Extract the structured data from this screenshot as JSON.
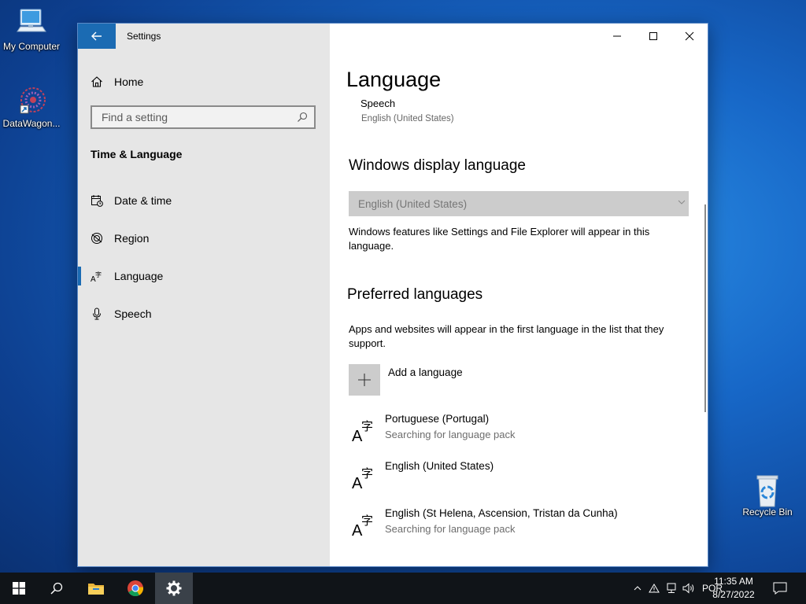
{
  "desktop": {
    "icons": [
      {
        "label": "My Computer",
        "icon": "computer-icon"
      },
      {
        "label": "DataWagon...",
        "icon": "datawagon-shortcut-icon"
      },
      {
        "label": "Recycle Bin",
        "icon": "recycle-bin-icon"
      }
    ]
  },
  "window": {
    "title": "Settings",
    "controls": {
      "minimize": "minimize-icon",
      "maximize": "maximize-icon",
      "close": "close-icon"
    }
  },
  "sidebar": {
    "home_label": "Home",
    "search_placeholder": "Find a setting",
    "section_title": "Time & Language",
    "items": [
      {
        "label": "Date & time",
        "icon": "calendar-clock-icon"
      },
      {
        "label": "Region",
        "icon": "globe-icon"
      },
      {
        "label": "Language",
        "icon": "language-icon",
        "selected": true
      },
      {
        "label": "Speech",
        "icon": "microphone-icon"
      }
    ]
  },
  "main": {
    "page_title": "Language",
    "speech": {
      "label": "Speech",
      "value": "English (United States)"
    },
    "display_language": {
      "heading": "Windows display language",
      "selected": "English (United States)",
      "description": "Windows features like Settings and File Explorer will appear in this language."
    },
    "preferred": {
      "heading": "Preferred languages",
      "description": "Apps and websites will appear in the first language in the list that they support.",
      "add_label": "Add a language",
      "languages": [
        {
          "name": "Portuguese (Portugal)",
          "status": "Searching for language pack"
        },
        {
          "name": "English (United States)",
          "status": ""
        },
        {
          "name": "English (St Helena, Ascension, Tristan da Cunha)",
          "status": "Searching for language pack"
        }
      ]
    }
  },
  "taskbar": {
    "apps": [
      "start-icon",
      "search-icon",
      "file-explorer-icon",
      "chrome-icon",
      "settings-icon"
    ],
    "language_indicator": "POR",
    "time": "11:35 AM",
    "date": "8/27/2022"
  },
  "colors": {
    "accent": "#1b6bb3",
    "sidebar_bg": "#e6e6e6",
    "taskbar_bg": "#101418"
  }
}
